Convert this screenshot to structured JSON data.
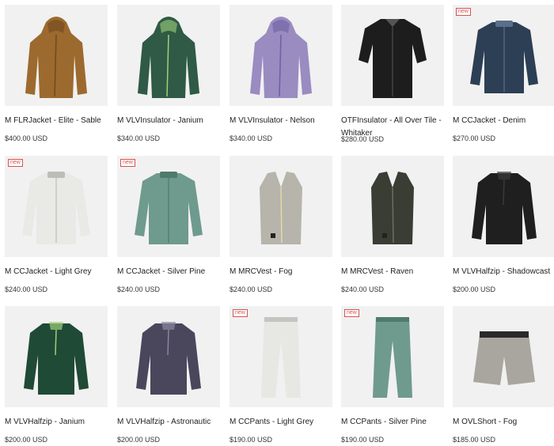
{
  "products": [
    {
      "name": "M FLRJacket - Elite - Sable",
      "price": "$400.00 USD",
      "badge": "",
      "kind": "hoodie",
      "color": "#9c6a2e",
      "accent": "#6f4a1e"
    },
    {
      "name": "M VLVInsulator - Janium",
      "price": "$340.00 USD",
      "badge": "",
      "kind": "hoodie",
      "color": "#2f5a45",
      "accent": "#9fd07a"
    },
    {
      "name": "M VLVInsulator - Nelson",
      "price": "$340.00 USD",
      "badge": "",
      "kind": "hoodie",
      "color": "#9a8bc1",
      "accent": "#6e60a0"
    },
    {
      "name": "OTFInsulator - All Over Tile - Whitaker",
      "price": "$280.00 USD",
      "badge": "",
      "kind": "shirt",
      "color": "#1d1d1d",
      "accent": "#555555"
    },
    {
      "name": "M CCJacket - Denim",
      "price": "$270.00 USD",
      "badge": "new",
      "kind": "jacket",
      "color": "#2d3f55",
      "accent": "#5a6f88"
    },
    {
      "name": "M CCJacket - Light Grey",
      "price": "$240.00 USD",
      "badge": "new",
      "kind": "jacket",
      "color": "#e9e9e6",
      "accent": "#bdbdb8"
    },
    {
      "name": "M CCJacket - Silver Pine",
      "price": "$240.00 USD",
      "badge": "new",
      "kind": "jacket",
      "color": "#6f9a8e",
      "accent": "#4f7a6e"
    },
    {
      "name": "M MRCVest - Fog",
      "price": "$240.00 USD",
      "badge": "",
      "kind": "vest",
      "color": "#b6b4ab",
      "accent": "#e4d9a8"
    },
    {
      "name": "M MRCVest - Raven",
      "price": "$240.00 USD",
      "badge": "",
      "kind": "vest",
      "color": "#3a3d33",
      "accent": "#6b6f60"
    },
    {
      "name": "M VLVHalfzip - Shadowcast",
      "price": "$200.00 USD",
      "badge": "",
      "kind": "halfzip",
      "color": "#1f1f1f",
      "accent": "#3a3a3a"
    },
    {
      "name": "M VLVHalfzip - Janium",
      "price": "$200.00 USD",
      "badge": "",
      "kind": "halfzip",
      "color": "#1f4a36",
      "accent": "#9fd07a"
    },
    {
      "name": "M VLVHalfzip - Astronautic",
      "price": "$200.00 USD",
      "badge": "",
      "kind": "halfzip",
      "color": "#4a465c",
      "accent": "#8a86a0"
    },
    {
      "name": "M CCPants - Light Grey",
      "price": "$190.00 USD",
      "badge": "new",
      "kind": "pants",
      "color": "#e7e8e4",
      "accent": "#c4c5c0"
    },
    {
      "name": "M CCPants - Silver Pine",
      "price": "$190.00 USD",
      "badge": "new",
      "kind": "pants",
      "color": "#6f9a8e",
      "accent": "#4f7a6e"
    },
    {
      "name": "M OVLShort - Fog",
      "price": "$185.00 USD",
      "badge": "",
      "kind": "shorts",
      "color": "#a8a69f",
      "accent": "#2a2a2a"
    }
  ]
}
